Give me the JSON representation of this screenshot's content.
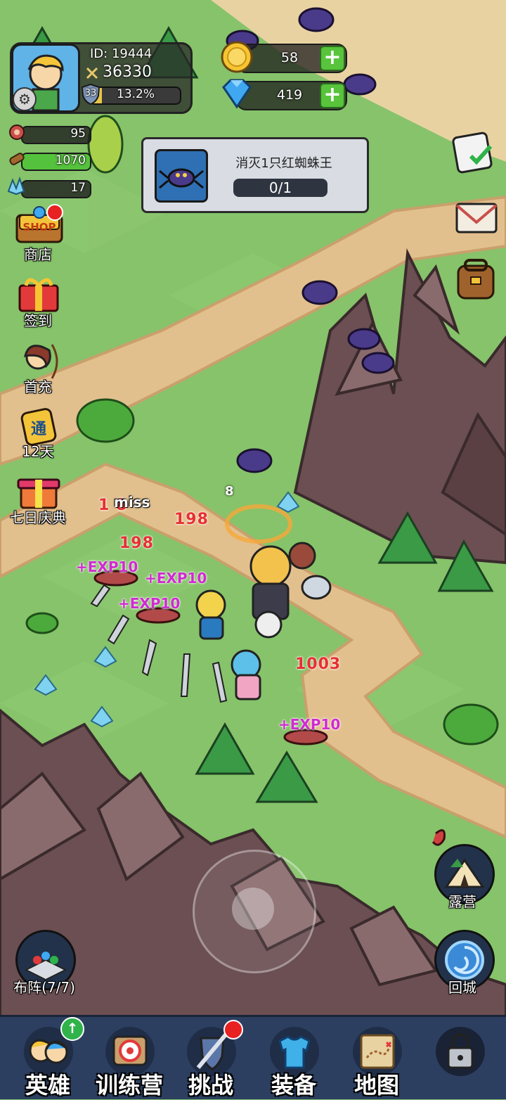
{
  "player": {
    "id_label": "ID: 19444",
    "power": "36330",
    "level": "33",
    "exp_percent": "13.2%",
    "exp_fraction": 0.132
  },
  "currency": {
    "gold": "58",
    "diamond": "419"
  },
  "resources": {
    "meat": "95",
    "wood": "1070",
    "crystal": "17"
  },
  "quest": {
    "title": "消灭1只红蜘蛛王",
    "progress": "0/1"
  },
  "side_menu": {
    "shop_badge": "SHOP",
    "shop": "商店",
    "sign_in": "签到",
    "first_charge": "首充",
    "pass_badge": "通",
    "pass_days": "12天",
    "festival": "七日庆典"
  },
  "combat_text": {
    "miss": "miss",
    "dmg_1": "198",
    "dmg_2": "198",
    "dmg_3": "1003",
    "dmg_partial": "1 8",
    "hit_small": "8",
    "exp_1": "+EXP10",
    "exp_2": "+EXP10",
    "exp_3": "+EXP10",
    "exp_4": "+EXP10"
  },
  "right_buttons": {
    "camp": "露营",
    "return_city": "回城"
  },
  "formation": {
    "label": "布阵(7/7)"
  },
  "bottom_nav": {
    "heroes": "英雄",
    "training": "训练营",
    "challenge": "挑战",
    "equipment": "装备",
    "map": "地图"
  },
  "colors": {
    "grass": "#86c36a",
    "path": "#e2c08e",
    "mountain": "#6b4f52",
    "nav_bg": "#2c3f60",
    "exp_text": "#d02ad0",
    "damage_text": "#e83030"
  }
}
